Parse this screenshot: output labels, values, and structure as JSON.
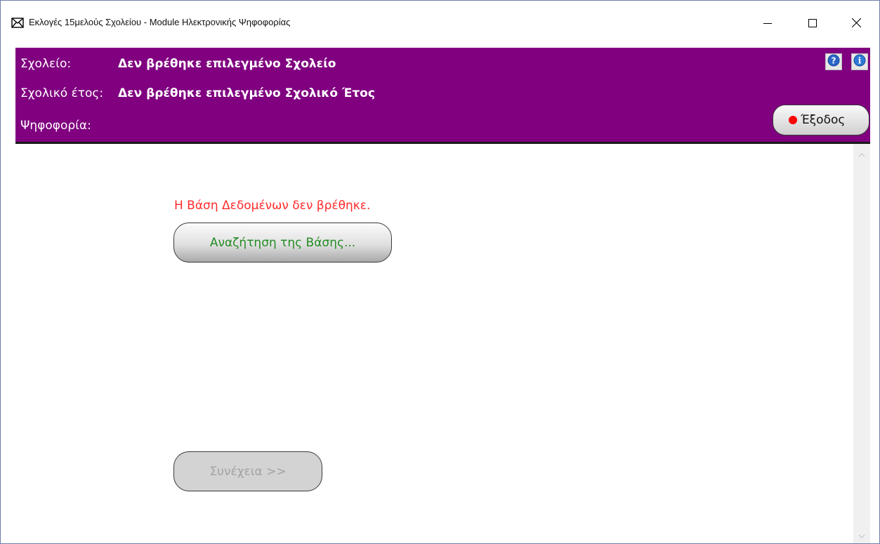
{
  "window": {
    "title": "Εκλογές 15μελούς Σχολείου - Module Ηλεκτρονικής Ψηφοφορίας",
    "icon": "envelope-icon",
    "controls": [
      "minimize-icon",
      "maximize-icon",
      "close-icon"
    ]
  },
  "header": {
    "background": "#800080",
    "school_label": "Σχολείο:",
    "school_value": "Δεν βρέθηκε επιλεγμένο Σχολείο",
    "year_label": "Σχολικό έτος:",
    "year_value": "Δεν βρέθηκε επιλεγμένο Σχολικό Έτος",
    "vote_label": "Ψηφοφορία:",
    "vote_value": "",
    "help_icon": "help-icon",
    "info_icon": "info-icon",
    "exit_label": "Έξοδος",
    "exit_dot_color": "#ff0000"
  },
  "main": {
    "error_message": "Η Βάση Δεδομένων δεν βρέθηκε.",
    "error_color": "#ff2a2a",
    "search_button_label": "Αναζήτηση της Βάσης...",
    "search_button_color": "#228b22",
    "continue_button_label": "Συνέχεια >>",
    "continue_button_enabled": false
  }
}
